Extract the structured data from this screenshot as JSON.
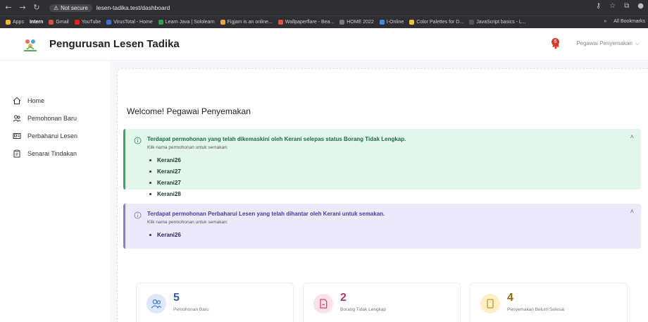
{
  "browser": {
    "security_label": "Not secure",
    "url": "lesen-tadika.test/dashboard",
    "bookmarks": [
      {
        "label": "Apps",
        "color": "#f2b632",
        "strong": false
      },
      {
        "label": "Intern",
        "color": "",
        "strong": true
      },
      {
        "label": "Gmail",
        "color": "#e04b3a",
        "strong": false
      },
      {
        "label": "YouTube",
        "color": "#e62117",
        "strong": false
      },
      {
        "label": "VirusTotal - Home",
        "color": "#3b6fd9",
        "strong": false
      },
      {
        "label": "Learn Java | Sololearn",
        "color": "#2ea34a",
        "strong": false
      },
      {
        "label": "Figjam is an online...",
        "color": "#f2a23b",
        "strong": false
      },
      {
        "label": "Wallpaperflare - Bea...",
        "color": "#e8503a",
        "strong": false
      },
      {
        "label": "HOME 2022",
        "color": "#7a7a7a",
        "strong": false
      },
      {
        "label": "I-Online",
        "color": "#3a8ee8",
        "strong": false
      },
      {
        "label": "Color Palettes for D...",
        "color": "#f4c430",
        "strong": false
      },
      {
        "label": "JavaScript basics - L...",
        "color": "#555",
        "strong": false
      }
    ],
    "overflow_label": "»",
    "all_bookmarks_label": "All Bookmarks"
  },
  "header": {
    "title": "Pengurusan Lesen Tadika",
    "notification_count": "5",
    "user_label": "Pegawai Penyemakan"
  },
  "sidebar": {
    "items": [
      {
        "label": "Home",
        "icon": "home-icon"
      },
      {
        "label": "Pemohonan Baru",
        "icon": "users-icon"
      },
      {
        "label": "Perbaharui Lesen",
        "icon": "id-card-icon"
      },
      {
        "label": "Senarai Tindakan",
        "icon": "clipboard-icon"
      }
    ]
  },
  "main": {
    "welcome": "Welcome! Pegawai Penyemakan",
    "alerts": [
      {
        "title": "Terdapat permohonan yang telah dikemaskini oleh Kerani selepas status Borang Tidak Lengkap.",
        "subtitle": "Klik nama permohonan untuk semakan:",
        "items": [
          "Kerani26",
          "Kerani27",
          "Kerani27",
          "Kerani28"
        ],
        "color": "#3aa66b"
      },
      {
        "title": "Terdapat permohonan Perbaharui Lesen yang telah dihantar oleh Kerani untuk semakan.",
        "subtitle": "Klik nama permohonan untuk semakan:",
        "items": [
          "Kerani26"
        ],
        "color": "#8d7bd6"
      }
    ],
    "stats": [
      {
        "value": "5",
        "label": "Pemohonan Baru",
        "color": "#4a7fd4",
        "bg": "#dde9fb"
      },
      {
        "value": "2",
        "label": "Borang Tidak Lengkap",
        "color": "#d9447a",
        "bg": "#fbe1ea"
      },
      {
        "value": "4",
        "label": "Penyemakan Belum Selesai",
        "color": "#c99a1a",
        "bg": "#fdf0c8"
      }
    ]
  }
}
